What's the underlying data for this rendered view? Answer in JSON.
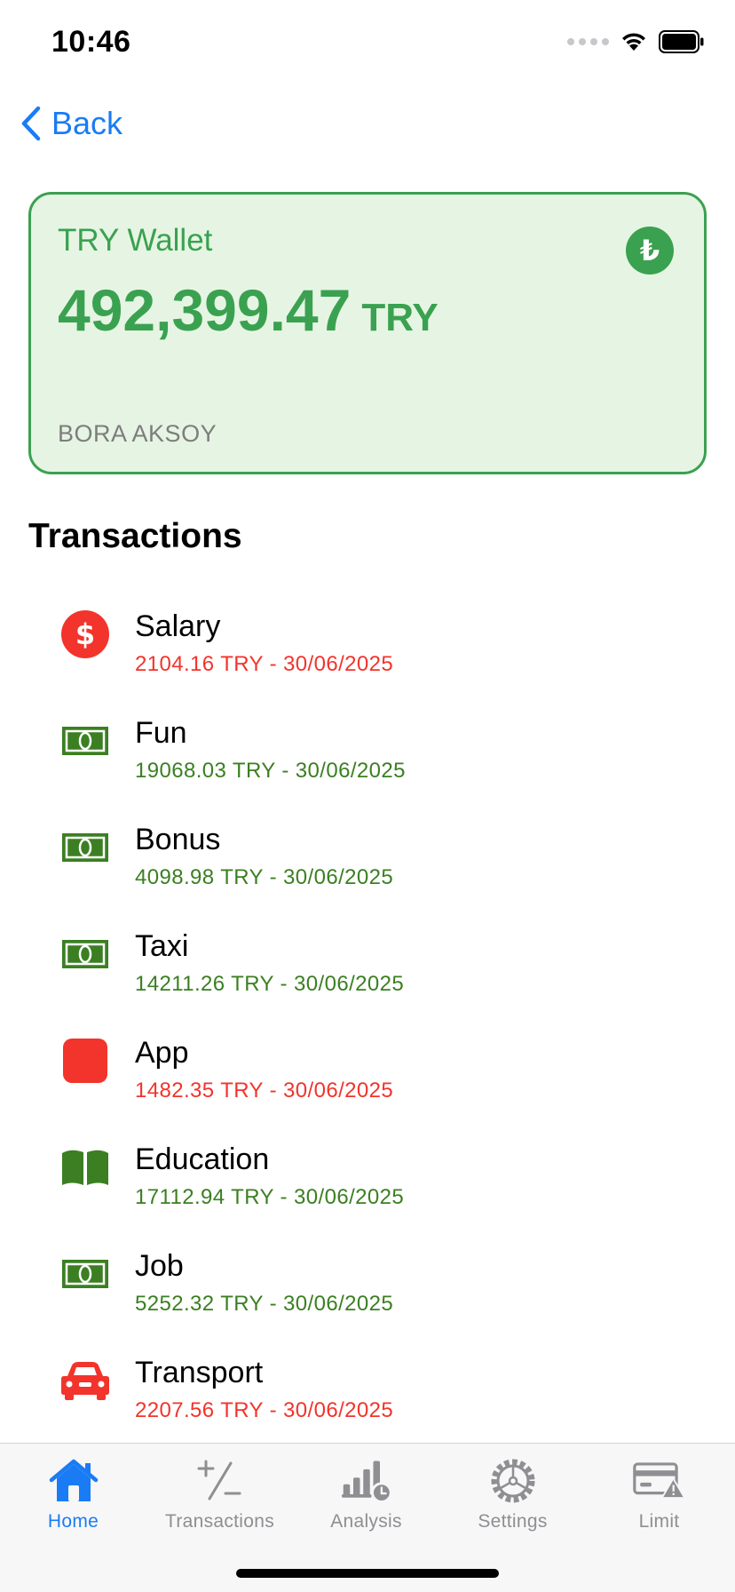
{
  "status_bar": {
    "time": "10:46"
  },
  "nav": {
    "back_label": "Back"
  },
  "wallet": {
    "title": "TRY Wallet",
    "balance": "492,399.47",
    "currency": "TRY",
    "owner": "BORA AKSOY",
    "badge_symbol": "₺",
    "accent_color": "#3aa150",
    "background_color": "#e6f5e3"
  },
  "transactions": {
    "title": "Transactions",
    "items": [
      {
        "name": "Salary",
        "detail": "2104.16 TRY - 30/06/2025",
        "type": "expense",
        "icon": "dollar-circle-icon"
      },
      {
        "name": "Fun",
        "detail": "19068.03 TRY - 30/06/2025",
        "type": "income",
        "icon": "banknote-icon"
      },
      {
        "name": "Bonus",
        "detail": "4098.98 TRY - 30/06/2025",
        "type": "income",
        "icon": "banknote-icon"
      },
      {
        "name": "Taxi",
        "detail": "14211.26 TRY - 30/06/2025",
        "type": "income",
        "icon": "banknote-icon"
      },
      {
        "name": "App",
        "detail": "1482.35 TRY - 30/06/2025",
        "type": "expense",
        "icon": "app-square-icon"
      },
      {
        "name": "Education",
        "detail": "17112.94 TRY - 30/06/2025",
        "type": "income",
        "icon": "book-icon"
      },
      {
        "name": "Job",
        "detail": "5252.32 TRY - 30/06/2025",
        "type": "income",
        "icon": "banknote-icon"
      },
      {
        "name": "Transport",
        "detail": "2207.56 TRY - 30/06/2025",
        "type": "expense",
        "icon": "car-icon"
      }
    ]
  },
  "tab_bar": {
    "tabs": [
      {
        "label": "Home",
        "icon": "house-icon",
        "active": true
      },
      {
        "label": "Transactions",
        "icon": "plus-minus-icon",
        "active": false
      },
      {
        "label": "Analysis",
        "icon": "chart-clock-icon",
        "active": false
      },
      {
        "label": "Settings",
        "icon": "gear-icon",
        "active": false
      },
      {
        "label": "Limit",
        "icon": "card-warning-icon",
        "active": false
      }
    ]
  },
  "colors": {
    "expense": "#f2342c",
    "income": "#3b7f22",
    "tint": "#1a7cf5",
    "inactive_tab": "#8e8e93"
  }
}
